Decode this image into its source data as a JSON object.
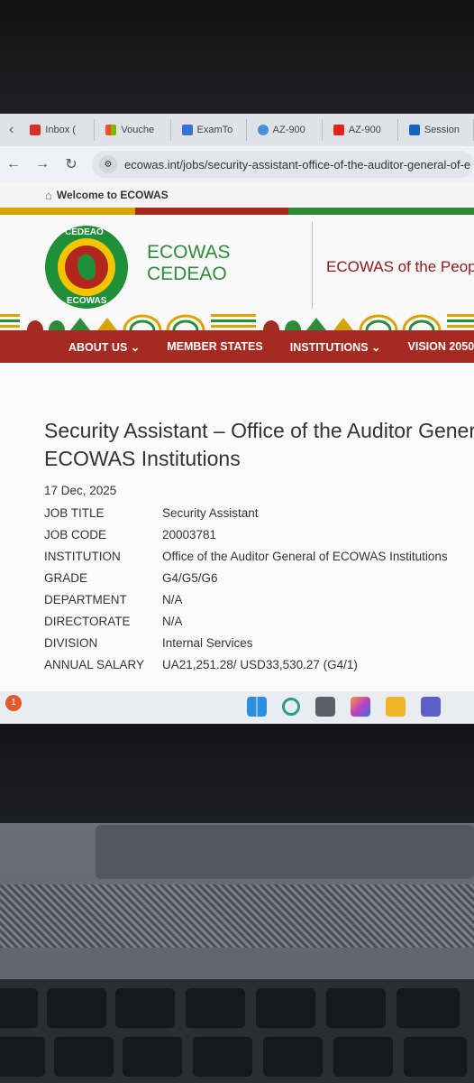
{
  "browser": {
    "tabs": [
      {
        "label": "Inbox (",
        "icon": "gmail-icon",
        "color": "#d93025"
      },
      {
        "label": "Vouche",
        "icon": "microsoft-icon",
        "color": "#f25022"
      },
      {
        "label": "ExamTo",
        "icon": "list-icon",
        "color": "#3a6fd8"
      },
      {
        "label": "AZ-900",
        "icon": "azure-cloud-icon",
        "color": "#4a90d9"
      },
      {
        "label": "AZ-900",
        "icon": "youtube-icon",
        "color": "#e62117"
      },
      {
        "label": "Session",
        "icon": "azure-icon",
        "color": "#1565c0"
      }
    ],
    "url": "ecowas.int/jobs/security-assistant-office-of-the-auditor-general-of-e"
  },
  "site": {
    "welcome": "Welcome to ECOWAS",
    "brand_line1": "ECOWAS",
    "brand_line2": "CEDEAO",
    "logo_top": "CEDEAO",
    "logo_bottom": "ECOWAS",
    "tagline": "ECOWAS of the Peopl",
    "nav": [
      "ABOUT US",
      "MEMBER STATES",
      "INSTITUTIONS",
      "VISION 2050"
    ],
    "colors": {
      "green": "#2e8b3a",
      "red": "#a52a22",
      "gold": "#d9a400"
    }
  },
  "job": {
    "title": "Security Assistant – Office of the Auditor General of ECOWAS Institutions",
    "date": "17 Dec, 2025",
    "fields": [
      {
        "key": "JOB TITLE",
        "value": "Security Assistant"
      },
      {
        "key": "JOB CODE",
        "value": "20003781"
      },
      {
        "key": "INSTITUTION",
        "value": "Office of the Auditor General of ECOWAS Institutions"
      },
      {
        "key": "GRADE",
        "value": "G4/G5/G6"
      },
      {
        "key": "DEPARTMENT",
        "value": "N/A"
      },
      {
        "key": "DIRECTORATE",
        "value": "N/A"
      },
      {
        "key": "DIVISION",
        "value": "Internal Services"
      },
      {
        "key": "ANNUAL SALARY",
        "value": "UA21,251.28/ USD33,530.27 (G4/1)"
      }
    ]
  },
  "taskbar": {
    "badge": "1",
    "icons": [
      "windows-start-icon",
      "search-icon",
      "task-view-icon",
      "copilot-icon",
      "file-explorer-icon",
      "teams-icon"
    ]
  }
}
